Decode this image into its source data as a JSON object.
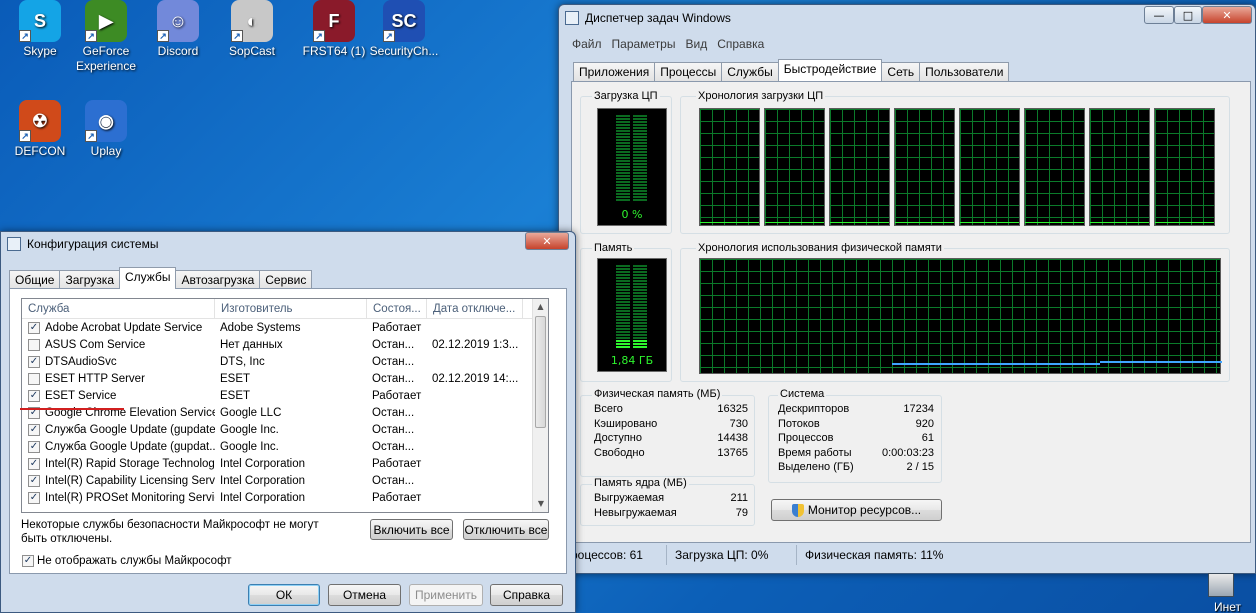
{
  "desktop": {
    "icons": [
      {
        "label": "Skype",
        "glyph": "S",
        "color": "#14a4e6"
      },
      {
        "label": "GeForce Experience",
        "glyph": "▶",
        "color": "#3d8b24"
      },
      {
        "label": "Discord",
        "glyph": "☺",
        "color": "#7289da"
      },
      {
        "label": "SopCast",
        "glyph": "◐",
        "color": "#c8c8c8"
      },
      {
        "label": "FRST64 (1)",
        "glyph": "F",
        "color": "#8a1a2a"
      },
      {
        "label": "SecurityCh...",
        "glyph": "SC",
        "color": "#1f4fb3"
      },
      {
        "label": "DEFCON",
        "glyph": "☢",
        "color": "#d04a1a"
      },
      {
        "label": "Uplay",
        "glyph": "◉",
        "color": "#2c6fd1"
      }
    ]
  },
  "task_manager": {
    "title": "Диспетчер задач Windows",
    "menu": [
      "Файл",
      "Параметры",
      "Вид",
      "Справка"
    ],
    "tabs": [
      "Приложения",
      "Процессы",
      "Службы",
      "Быстродействие",
      "Сеть",
      "Пользователи"
    ],
    "cpu_label": "Загрузка ЦП",
    "cpu_value": "0 %",
    "cpu_fraction": 0.0,
    "cpu_history_label": "Хронология загрузки ЦП",
    "memory_label": "Память",
    "memory_value": "1,84 ГБ",
    "memory_fraction": 0.11,
    "memory_history_label": "Хронология использования физической памяти",
    "physical_memory": {
      "title": "Физическая память (МБ)",
      "rows": [
        {
          "label": "Всего",
          "value": "16325"
        },
        {
          "label": "Кэшировано",
          "value": "730"
        },
        {
          "label": "Доступно",
          "value": "14438"
        },
        {
          "label": "Свободно",
          "value": "13765"
        }
      ]
    },
    "kernel_memory": {
      "title": "Память ядра (МБ)",
      "rows": [
        {
          "label": "Выгружаемая",
          "value": "211"
        },
        {
          "label": "Невыгружаемая",
          "value": "79"
        }
      ]
    },
    "system": {
      "title": "Система",
      "rows": [
        {
          "label": "Дескрипторов",
          "value": "17234"
        },
        {
          "label": "Потоков",
          "value": "920"
        },
        {
          "label": "Процессов",
          "value": "61"
        },
        {
          "label": "Время работы",
          "value": "0:00:03:23"
        },
        {
          "label": "Выделено (ГБ)",
          "value": "2 / 15"
        }
      ]
    },
    "resource_monitor_button": "Монитор ресурсов...",
    "status": {
      "processes": "роцессов: 61",
      "cpu": "Загрузка ЦП: 0%",
      "memory": "Физическая память: 11%"
    }
  },
  "msconfig": {
    "title": "Конфигурация системы",
    "tabs": [
      "Общие",
      "Загрузка",
      "Службы",
      "Автозагрузка",
      "Сервис"
    ],
    "columns": [
      "Служба",
      "Изготовитель",
      "Состоя...",
      "Дата отключе..."
    ],
    "services": [
      {
        "name": "Adobe Acrobat Update Service",
        "maker": "Adobe Systems",
        "state": "Работает",
        "date": "",
        "checked": true
      },
      {
        "name": "ASUS Com Service",
        "maker": "Нет данных",
        "state": "Остан...",
        "date": "02.12.2019 1:3...",
        "checked": false
      },
      {
        "name": "DTSAudioSvc",
        "maker": "DTS, Inc",
        "state": "Остан...",
        "date": "",
        "checked": true
      },
      {
        "name": "ESET HTTP Server",
        "maker": "ESET",
        "state": "Остан...",
        "date": "02.12.2019 14:...",
        "checked": false
      },
      {
        "name": "ESET Service",
        "maker": "ESET",
        "state": "Работает",
        "date": "",
        "checked": true
      },
      {
        "name": "Google Chrome Elevation Service",
        "maker": "Google LLC",
        "state": "Остан...",
        "date": "",
        "checked": true
      },
      {
        "name": "Служба Google Update (gupdate)",
        "maker": "Google Inc.",
        "state": "Остан...",
        "date": "",
        "checked": true
      },
      {
        "name": "Служба Google Update (gupdat...",
        "maker": "Google Inc.",
        "state": "Остан...",
        "date": "",
        "checked": true
      },
      {
        "name": "Intel(R) Rapid Storage Technology",
        "maker": "Intel Corporation",
        "state": "Работает",
        "date": "",
        "checked": true
      },
      {
        "name": "Intel(R) Capability Licensing Serv...",
        "maker": "Intel Corporation",
        "state": "Остан...",
        "date": "",
        "checked": true
      },
      {
        "name": "Intel(R) PROSet Monitoring Service",
        "maker": "Intel Corporation",
        "state": "Работает",
        "date": "",
        "checked": true
      }
    ],
    "note": "Некоторые службы безопасности Майкрософт не могут быть отключены.",
    "enable_all": "Включить все",
    "disable_all": "Отключить все",
    "hide_ms_label": "Не отображать службы Майкрософт",
    "buttons": {
      "ok": "ОК",
      "cancel": "Отмена",
      "apply": "Применить",
      "help": "Справка"
    }
  },
  "taskbar_fragment": "Инет"
}
